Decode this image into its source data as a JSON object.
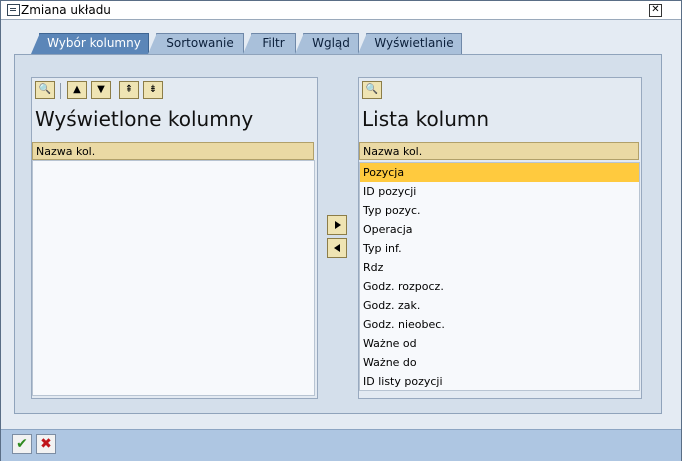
{
  "window": {
    "title": "Zmiana układu"
  },
  "tabs": [
    {
      "label": "Wybór kolumny"
    },
    {
      "label": "Sortowanie"
    },
    {
      "label": "Filtr"
    },
    {
      "label": "Wgląd"
    },
    {
      "label": "Wyświetlanie"
    }
  ],
  "left": {
    "heading": "Wyświetlone kolumny",
    "column_header": "Nazwa kol.",
    "toolbar_icons": [
      "find-icon",
      "move-up-icon",
      "move-down-icon",
      "move-top-icon",
      "move-bottom-icon"
    ]
  },
  "right": {
    "heading": "Lista kolumn",
    "column_header": "Nazwa kol.",
    "items": [
      "Pozycja",
      "ID pozycji",
      "Typ pozyc.",
      "Operacja",
      "Typ inf.",
      "Rdz",
      "Godz. rozpocz.",
      "Godz. zak.",
      "Godz. nieobec.",
      "Ważne od",
      "Ważne do",
      "ID listy pozycji"
    ],
    "selected_index": 0
  },
  "colors": {
    "selected_row": "#ffca3e",
    "active_tab": "#5b86b8",
    "confirm": "#2f8a1f",
    "cancel": "#c0141a"
  }
}
